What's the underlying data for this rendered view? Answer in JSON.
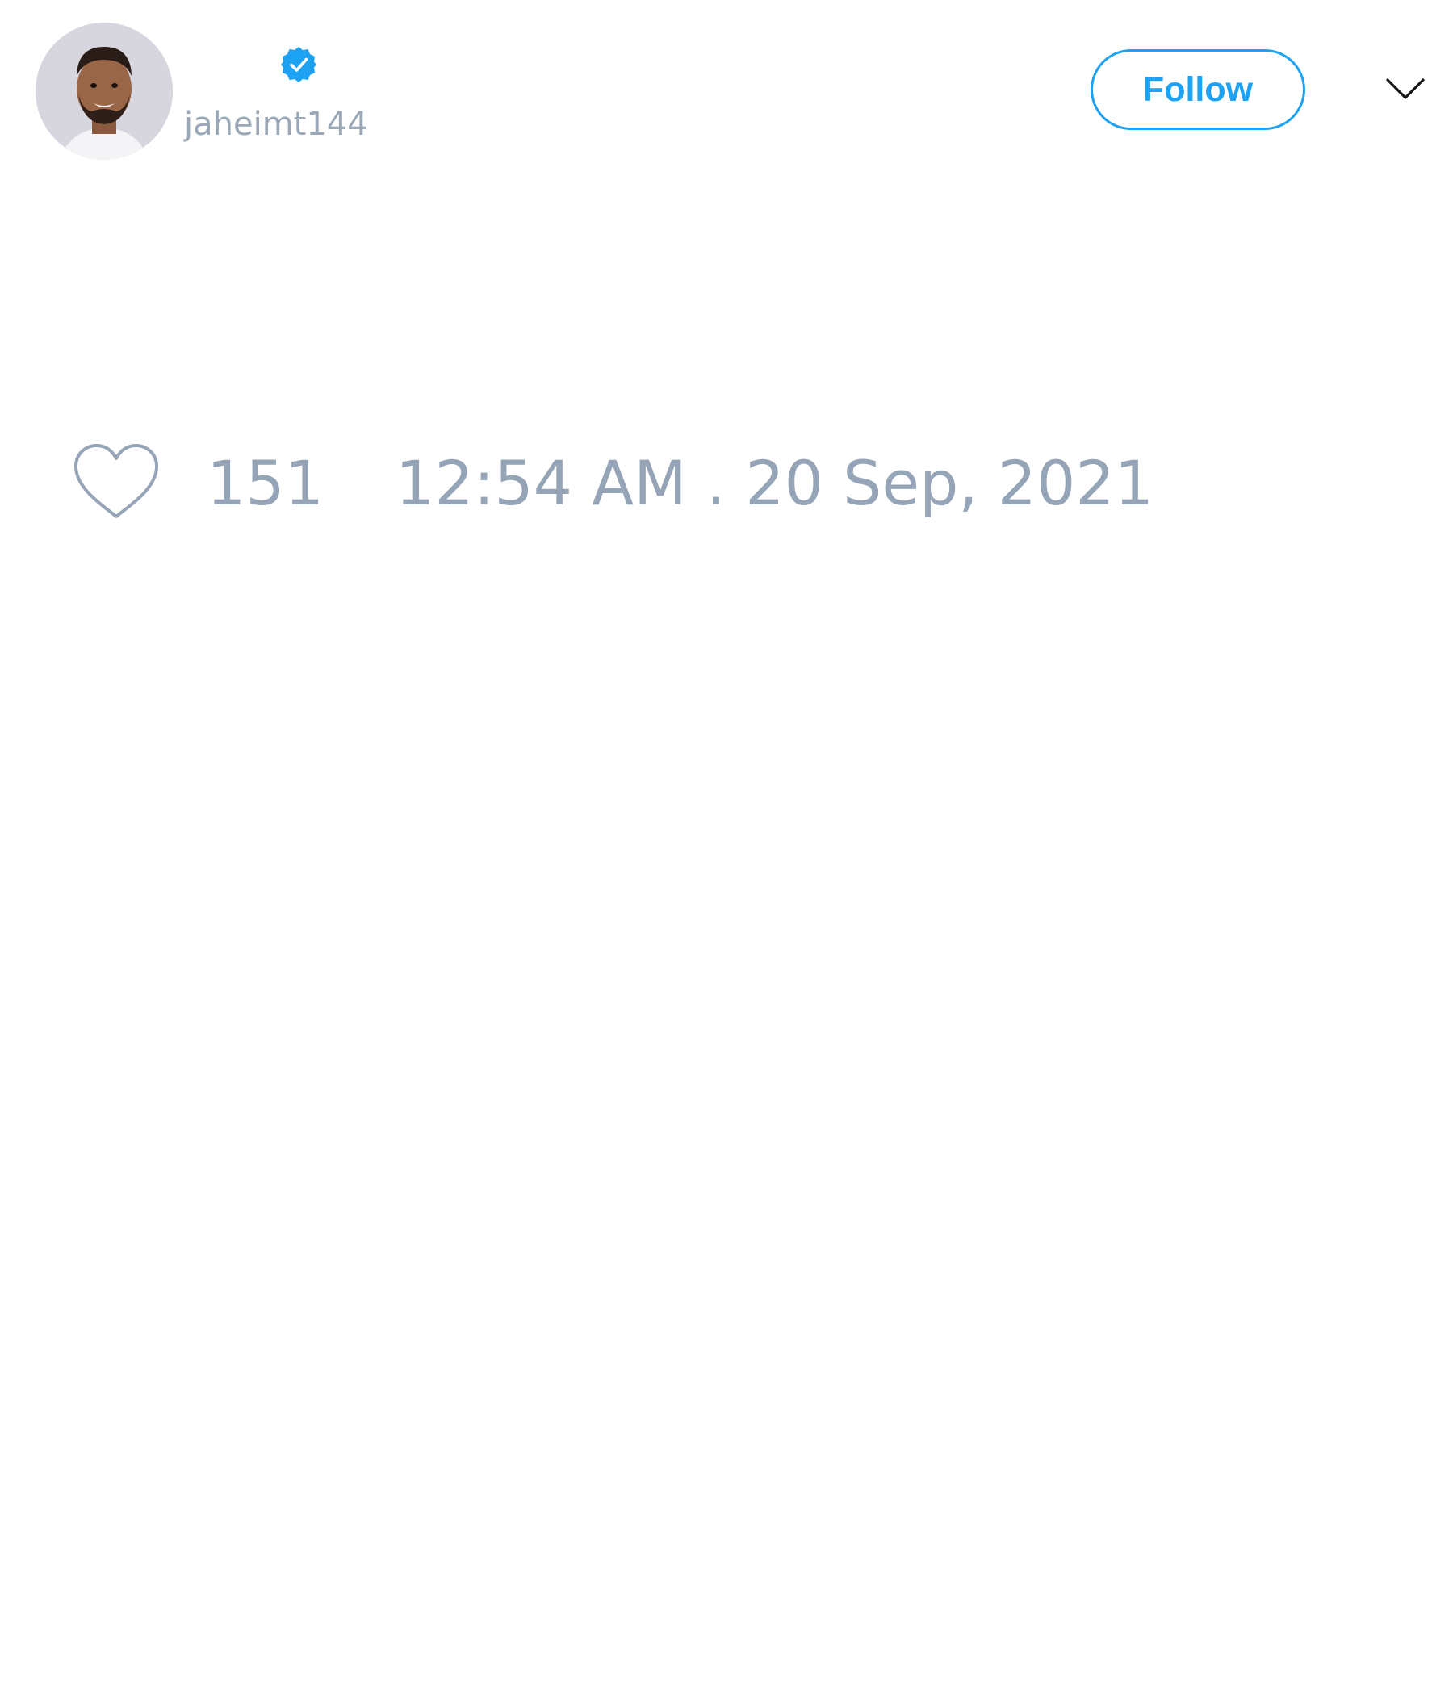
{
  "tweet": {
    "author": {
      "display_name": "",
      "handle": "jaheimt144",
      "verified": true,
      "avatar_icon": "profile-photo"
    },
    "follow_label": "Follow",
    "menu_icon": "chevron-down-icon",
    "likes": {
      "icon": "heart-outline-icon",
      "count": "151"
    },
    "timestamp": "12:54 AM . 20 Sep, 2021"
  },
  "colors": {
    "accent": "#1da1f2",
    "muted_text": "#95a4b6",
    "background": "#ffffff"
  }
}
